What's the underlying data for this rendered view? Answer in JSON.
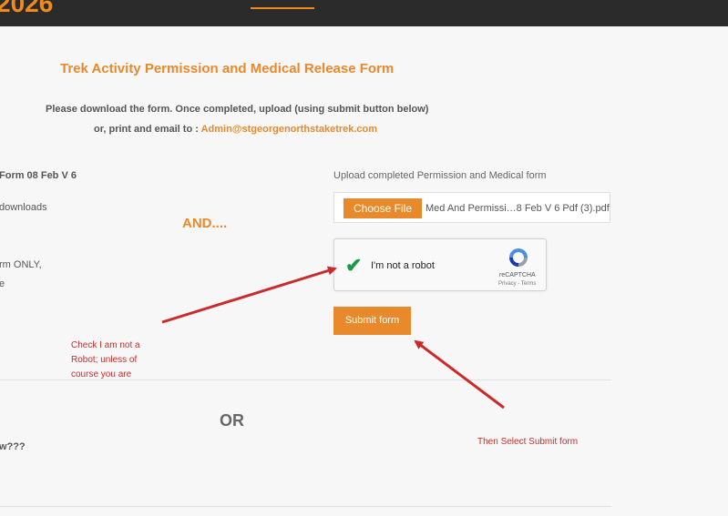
{
  "header": {
    "year_fragment": "2026"
  },
  "form": {
    "title": "Trek Activity Permission and Medical Release Form",
    "intro_line1": "Please download the form.  Once completed, upload (using submit button below)",
    "intro_line2_prefix": "or, print and email to :",
    "email": "Admin@stgeorgenorthstaketrek.com"
  },
  "left_fragments": {
    "form_version": "Form 08 Feb V 6",
    "downloads": "downloads",
    "form_only": "rm ONLY,",
    "e": "e",
    "question": "w???"
  },
  "and_label": "AND....",
  "upload": {
    "label": "Upload completed Permission and Medical form",
    "choose_file": "Choose File",
    "file_name": "Med And Permissi…8 Feb V 6 Pdf (3).pdf"
  },
  "captcha": {
    "label": "I'm not a robot",
    "brand": "reCAPTCHA",
    "terms": "Privacy - Terms"
  },
  "submit_label": "Submit form",
  "annotations": {
    "robot_note_line1": "Check I am not a",
    "robot_note_line2": "Robot;  unless of",
    "robot_note_line3": "course you are",
    "submit_note": "Then Select Submit form",
    "arrow_color": "#cc2a2a"
  },
  "or_label": "OR"
}
